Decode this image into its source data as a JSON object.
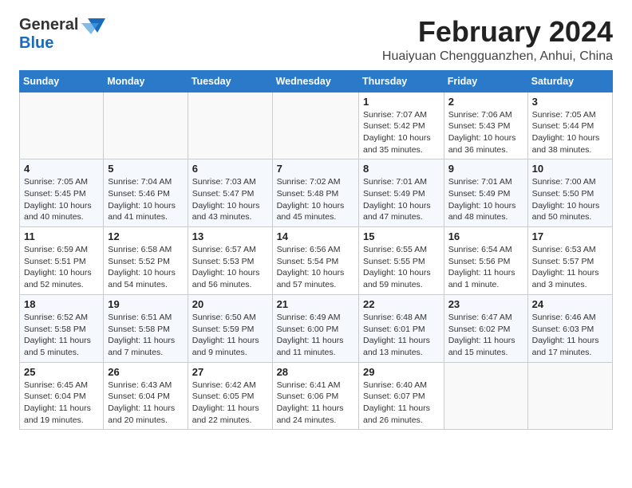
{
  "logo": {
    "general": "General",
    "blue": "Blue"
  },
  "title": "February 2024",
  "subtitle": "Huaiyuan Chengguanzhen, Anhui, China",
  "header": {
    "days": [
      "Sunday",
      "Monday",
      "Tuesday",
      "Wednesday",
      "Thursday",
      "Friday",
      "Saturday"
    ]
  },
  "weeks": [
    [
      {
        "day": "",
        "info": ""
      },
      {
        "day": "",
        "info": ""
      },
      {
        "day": "",
        "info": ""
      },
      {
        "day": "",
        "info": ""
      },
      {
        "day": "1",
        "info": "Sunrise: 7:07 AM\nSunset: 5:42 PM\nDaylight: 10 hours\nand 35 minutes."
      },
      {
        "day": "2",
        "info": "Sunrise: 7:06 AM\nSunset: 5:43 PM\nDaylight: 10 hours\nand 36 minutes."
      },
      {
        "day": "3",
        "info": "Sunrise: 7:05 AM\nSunset: 5:44 PM\nDaylight: 10 hours\nand 38 minutes."
      }
    ],
    [
      {
        "day": "4",
        "info": "Sunrise: 7:05 AM\nSunset: 5:45 PM\nDaylight: 10 hours\nand 40 minutes."
      },
      {
        "day": "5",
        "info": "Sunrise: 7:04 AM\nSunset: 5:46 PM\nDaylight: 10 hours\nand 41 minutes."
      },
      {
        "day": "6",
        "info": "Sunrise: 7:03 AM\nSunset: 5:47 PM\nDaylight: 10 hours\nand 43 minutes."
      },
      {
        "day": "7",
        "info": "Sunrise: 7:02 AM\nSunset: 5:48 PM\nDaylight: 10 hours\nand 45 minutes."
      },
      {
        "day": "8",
        "info": "Sunrise: 7:01 AM\nSunset: 5:49 PM\nDaylight: 10 hours\nand 47 minutes."
      },
      {
        "day": "9",
        "info": "Sunrise: 7:01 AM\nSunset: 5:49 PM\nDaylight: 10 hours\nand 48 minutes."
      },
      {
        "day": "10",
        "info": "Sunrise: 7:00 AM\nSunset: 5:50 PM\nDaylight: 10 hours\nand 50 minutes."
      }
    ],
    [
      {
        "day": "11",
        "info": "Sunrise: 6:59 AM\nSunset: 5:51 PM\nDaylight: 10 hours\nand 52 minutes."
      },
      {
        "day": "12",
        "info": "Sunrise: 6:58 AM\nSunset: 5:52 PM\nDaylight: 10 hours\nand 54 minutes."
      },
      {
        "day": "13",
        "info": "Sunrise: 6:57 AM\nSunset: 5:53 PM\nDaylight: 10 hours\nand 56 minutes."
      },
      {
        "day": "14",
        "info": "Sunrise: 6:56 AM\nSunset: 5:54 PM\nDaylight: 10 hours\nand 57 minutes."
      },
      {
        "day": "15",
        "info": "Sunrise: 6:55 AM\nSunset: 5:55 PM\nDaylight: 10 hours\nand 59 minutes."
      },
      {
        "day": "16",
        "info": "Sunrise: 6:54 AM\nSunset: 5:56 PM\nDaylight: 11 hours\nand 1 minute."
      },
      {
        "day": "17",
        "info": "Sunrise: 6:53 AM\nSunset: 5:57 PM\nDaylight: 11 hours\nand 3 minutes."
      }
    ],
    [
      {
        "day": "18",
        "info": "Sunrise: 6:52 AM\nSunset: 5:58 PM\nDaylight: 11 hours\nand 5 minutes."
      },
      {
        "day": "19",
        "info": "Sunrise: 6:51 AM\nSunset: 5:58 PM\nDaylight: 11 hours\nand 7 minutes."
      },
      {
        "day": "20",
        "info": "Sunrise: 6:50 AM\nSunset: 5:59 PM\nDaylight: 11 hours\nand 9 minutes."
      },
      {
        "day": "21",
        "info": "Sunrise: 6:49 AM\nSunset: 6:00 PM\nDaylight: 11 hours\nand 11 minutes."
      },
      {
        "day": "22",
        "info": "Sunrise: 6:48 AM\nSunset: 6:01 PM\nDaylight: 11 hours\nand 13 minutes."
      },
      {
        "day": "23",
        "info": "Sunrise: 6:47 AM\nSunset: 6:02 PM\nDaylight: 11 hours\nand 15 minutes."
      },
      {
        "day": "24",
        "info": "Sunrise: 6:46 AM\nSunset: 6:03 PM\nDaylight: 11 hours\nand 17 minutes."
      }
    ],
    [
      {
        "day": "25",
        "info": "Sunrise: 6:45 AM\nSunset: 6:04 PM\nDaylight: 11 hours\nand 19 minutes."
      },
      {
        "day": "26",
        "info": "Sunrise: 6:43 AM\nSunset: 6:04 PM\nDaylight: 11 hours\nand 20 minutes."
      },
      {
        "day": "27",
        "info": "Sunrise: 6:42 AM\nSunset: 6:05 PM\nDaylight: 11 hours\nand 22 minutes."
      },
      {
        "day": "28",
        "info": "Sunrise: 6:41 AM\nSunset: 6:06 PM\nDaylight: 11 hours\nand 24 minutes."
      },
      {
        "day": "29",
        "info": "Sunrise: 6:40 AM\nSunset: 6:07 PM\nDaylight: 11 hours\nand 26 minutes."
      },
      {
        "day": "",
        "info": ""
      },
      {
        "day": "",
        "info": ""
      }
    ]
  ]
}
